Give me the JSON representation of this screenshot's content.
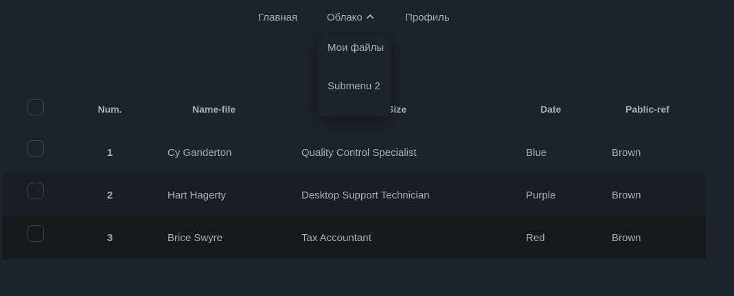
{
  "nav": {
    "home": "Главная",
    "cloud": "Облако",
    "profile": "Профиль",
    "cloud_icon": "chevron-up-icon"
  },
  "dropdown": {
    "items": [
      "Мои файлы",
      "Submenu 2"
    ]
  },
  "table": {
    "headers": [
      "Num.",
      "Name-file",
      "Size",
      "Date",
      "Pablic-ref"
    ],
    "rows": [
      {
        "num": "1",
        "name": "Cy Ganderton",
        "size": "Quality Control Specialist",
        "date": "Blue",
        "ref": "Brown"
      },
      {
        "num": "2",
        "name": "Hart Hagerty",
        "size": "Desktop Support Technician",
        "date": "Purple",
        "ref": "Brown"
      },
      {
        "num": "3",
        "name": "Brice Swyre",
        "size": "Tax Accountant",
        "date": "Red",
        "ref": "Brown"
      }
    ]
  },
  "colors": {
    "background": "#1d232a",
    "row_alt_1": "#191e24",
    "row_alt_2": "#15191e",
    "text": "#a6adbb"
  }
}
